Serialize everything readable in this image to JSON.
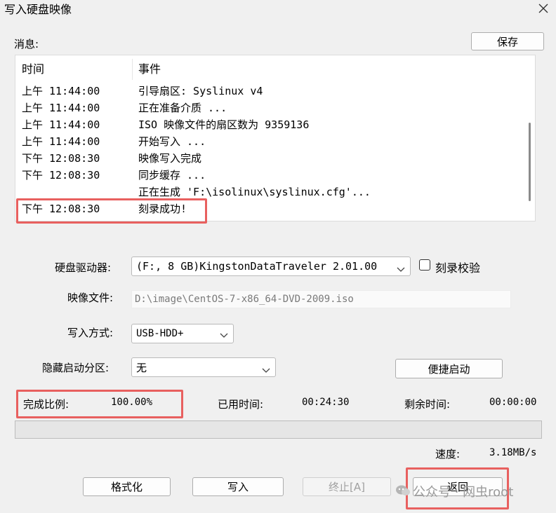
{
  "window": {
    "title": "写入硬盘映像",
    "close_icon": "close-icon"
  },
  "messages": {
    "label": "消息:",
    "save_button": "保存",
    "columns": {
      "time": "时间",
      "event": "事件"
    },
    "rows": [
      {
        "time": "上午 11:44:00",
        "event": "引导扇区: Syslinux v4"
      },
      {
        "time": "上午 11:44:00",
        "event": "正在准备介质 ..."
      },
      {
        "time": "上午 11:44:00",
        "event": "ISO 映像文件的扇区数为 9359136"
      },
      {
        "time": "上午 11:44:00",
        "event": "开始写入 ..."
      },
      {
        "time": "下午 12:08:30",
        "event": "映像写入完成"
      },
      {
        "time": "下午 12:08:30",
        "event": "同步缓存 ..."
      },
      {
        "time": "",
        "event": "正在生成 'F:\\isolinux\\syslinux.cfg'..."
      },
      {
        "time": "下午 12:08:30",
        "event": "刻录成功!"
      }
    ]
  },
  "settings": {
    "drive_label": "硬盘驱动器:",
    "drive_value": "(F:, 8 GB)KingstonDataTraveler 2.01.00",
    "verify_label": "刻录校验",
    "image_label": "映像文件:",
    "image_value": "D:\\image\\CentOS-7-x86_64-DVD-2009.iso",
    "write_mode_label": "写入方式:",
    "write_mode_value": "USB-HDD+",
    "hidden_partition_label": "隐藏启动分区:",
    "hidden_partition_value": "无",
    "quick_boot_button": "便捷启动"
  },
  "status": {
    "percent_label": "完成比例:",
    "percent_value": "100.00%",
    "elapsed_label": "已用时间:",
    "elapsed_value": "00:24:30",
    "remaining_label": "剩余时间:",
    "remaining_value": "00:00:00",
    "progress_fraction": 1.0,
    "speed_label": "速度:",
    "speed_value": "3.18MB/s"
  },
  "buttons": {
    "format": "格式化",
    "write": "写入",
    "stop": "终止[A]",
    "back": "返回"
  },
  "watermark": {
    "text": "公众号 · 网虫root"
  },
  "colors": {
    "highlight": "#e8605f",
    "window_bg": "#f0f0f0"
  }
}
